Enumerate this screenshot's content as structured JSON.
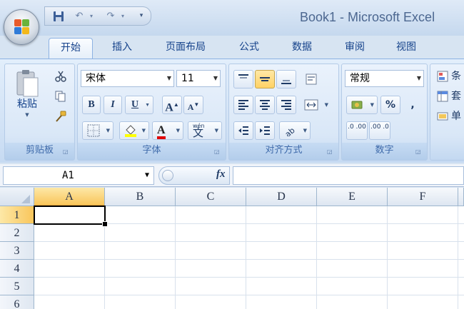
{
  "window": {
    "title": "Book1 - Microsoft Excel"
  },
  "qat": {
    "save_icon": "save-icon",
    "undo_glyph": "↶",
    "redo_glyph": "↷",
    "dropdown_glyph": "▾"
  },
  "tabs": [
    {
      "label": "开始",
      "active": true
    },
    {
      "label": "插入"
    },
    {
      "label": "页面布局"
    },
    {
      "label": "公式"
    },
    {
      "label": "数据"
    },
    {
      "label": "审阅"
    },
    {
      "label": "视图"
    }
  ],
  "clipboard": {
    "paste_label": "粘贴",
    "group_label": "剪贴板"
  },
  "font": {
    "name": "宋体",
    "size": "11",
    "bold": "B",
    "italic": "I",
    "underline": "U",
    "grow": "A",
    "shrink": "A",
    "font_color": "A",
    "phonetic": "wén",
    "phonetic_char": "文",
    "group_label": "字体"
  },
  "alignment": {
    "group_label": "对齐方式"
  },
  "number": {
    "format": "常规",
    "percent": "%",
    "comma": ",",
    "inc_decimal": ".0 .00",
    "dec_decimal": ".00 .0",
    "group_label": "数字"
  },
  "styles": {
    "label_1": "条",
    "label_2": "套",
    "label_3": "单"
  },
  "formula_bar": {
    "name_box": "A1",
    "fx": "fx"
  },
  "sheet": {
    "columns": [
      "A",
      "B",
      "C",
      "D",
      "E",
      "F"
    ],
    "rows": [
      "1",
      "2",
      "3",
      "4",
      "5",
      "6"
    ],
    "active_cell": "A1"
  },
  "colors": {
    "accent": "#15428b",
    "selection": "#f9c65b"
  }
}
